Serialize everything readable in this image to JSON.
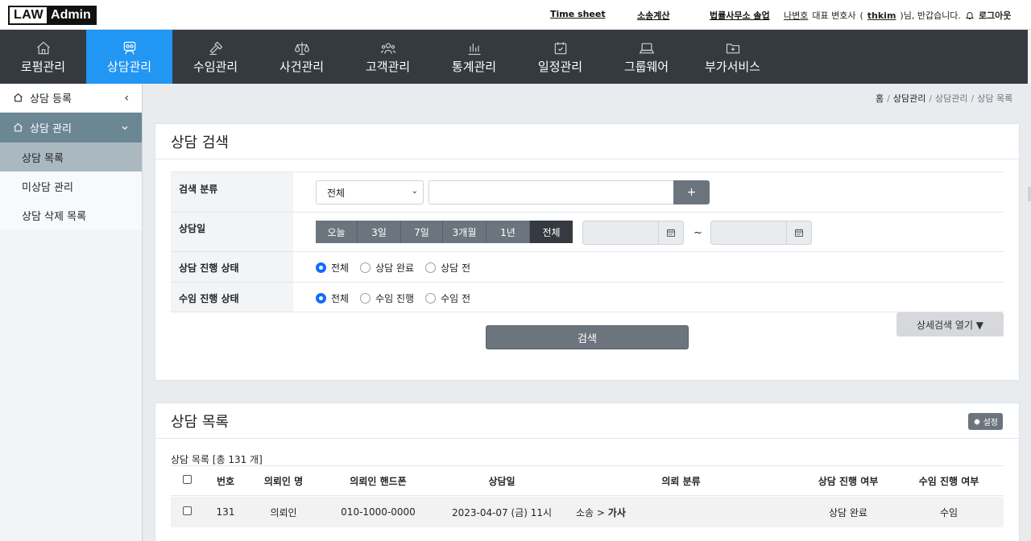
{
  "logo": {
    "part1": "LAW",
    "part2": "Admin"
  },
  "top_links": {
    "timesheet": "Time sheet",
    "calc": "소송계산",
    "office": "법률사무소 솔업"
  },
  "user": {
    "name": "나변호",
    "role": "대표 변호사",
    "open": "(",
    "id": "thkim",
    "greet": ")님, 반갑습니다.",
    "logout": "로그아웃"
  },
  "nav": [
    {
      "label": "로펌관리",
      "icon": "home-icon"
    },
    {
      "label": "상담관리",
      "icon": "consult-icon"
    },
    {
      "label": "수임관리",
      "icon": "gavel-icon"
    },
    {
      "label": "사건관리",
      "icon": "scale-icon"
    },
    {
      "label": "고객관리",
      "icon": "users-icon"
    },
    {
      "label": "통계관리",
      "icon": "chart-icon"
    },
    {
      "label": "일정관리",
      "icon": "calendar-icon"
    },
    {
      "label": "그룹웨어",
      "icon": "laptop-icon"
    },
    {
      "label": "부가서비스",
      "icon": "folder-plus-icon"
    }
  ],
  "sidebar": {
    "register": "상담 등록",
    "group": "상담 관리",
    "items": [
      "상담 목록",
      "미상담 관리",
      "상담 삭제 목록"
    ]
  },
  "breadcrumb": {
    "home": "홈",
    "c1": "상담관리",
    "c2": "상담관리",
    "c3": "상담 목록",
    "sep": "/"
  },
  "search": {
    "title": "상담 검색",
    "label_type": "검색 분류",
    "select_value": "전체",
    "plus": "+",
    "label_date": "상담일",
    "date_buttons": [
      "오늘",
      "3일",
      "7일",
      "3개월",
      "1년",
      "전체"
    ],
    "tilde": "~",
    "label_status": "상담 진행 상태",
    "status_options": [
      "전체",
      "상담 완료",
      "상담 전"
    ],
    "label_case": "수임 진행 상태",
    "case_options": [
      "전체",
      "수임 진행",
      "수임 전"
    ],
    "search_button": "검색",
    "advanced_button": "상세검색 열기 ▼"
  },
  "list": {
    "title": "상담 목록",
    "settings": "설정",
    "count": "상담 목록 [총 131 개]",
    "columns": [
      "번호",
      "의뢰인 명",
      "의뢰인 핸드폰",
      "상담일",
      "의뢰 분류",
      "상담 진행 여부",
      "수임 진행 여부"
    ],
    "rows": [
      {
        "no": "131",
        "client": "의뢰인",
        "phone": "010-1000-0000",
        "date": "2023-04-07 (금) 11시",
        "cat1": "소송 >",
        "cat2": "가사",
        "status": "상담 완료",
        "case": "수임"
      }
    ]
  }
}
